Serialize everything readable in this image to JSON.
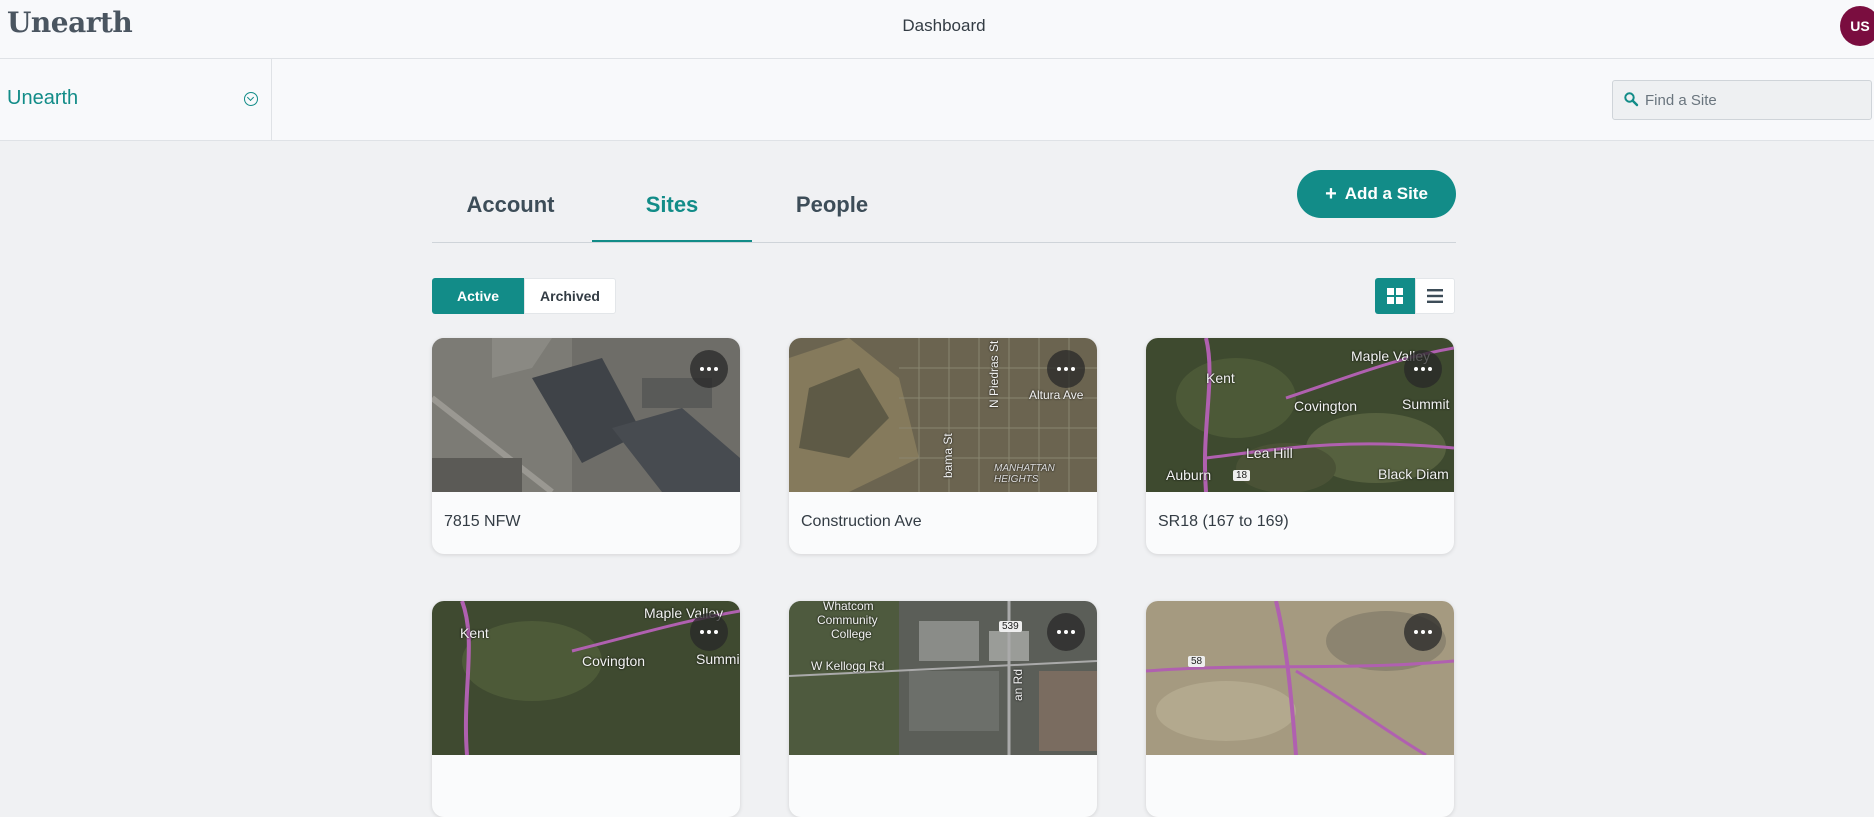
{
  "header": {
    "logo": "Unearth",
    "title": "Dashboard",
    "avatar_initials": "US"
  },
  "subheader": {
    "org_name": "Unearth",
    "search_placeholder": "Find a Site"
  },
  "tabs": [
    {
      "label": "Account",
      "active": false
    },
    {
      "label": "Sites",
      "active": true
    },
    {
      "label": "People",
      "active": false
    }
  ],
  "add_site_label": "Add a Site",
  "filter": {
    "active_label": "Active",
    "archived_label": "Archived"
  },
  "sites": [
    {
      "name": "7815 NFW",
      "imagery": "aerial-buildings"
    },
    {
      "name": "Construction Ave",
      "imagery": "aerial-hills-grid",
      "map_labels": [
        "Altura Ave",
        "N Piedras St",
        "bama St",
        "MANHATTAN HEIGHTS"
      ]
    },
    {
      "name": "SR18 (167 to 169)",
      "imagery": "aerial-map",
      "map_labels": [
        "Maple Valley",
        "Kent",
        "Covington",
        "Summit",
        "Lea Hill",
        "Auburn",
        "18",
        "Black Diam"
      ]
    },
    {
      "name": "",
      "imagery": "aerial-map",
      "map_labels": [
        "Maple Valley",
        "Kent",
        "Covington",
        "Summi"
      ]
    },
    {
      "name": "",
      "imagery": "aerial-city",
      "map_labels": [
        "Whatcom",
        "Community",
        "College",
        "W Kellogg Rd",
        "539",
        "an Rd"
      ]
    },
    {
      "name": "",
      "imagery": "aerial-desert",
      "map_labels": [
        "58"
      ]
    }
  ],
  "colors": {
    "accent": "#128c88",
    "avatar": "#7a0d3f"
  }
}
